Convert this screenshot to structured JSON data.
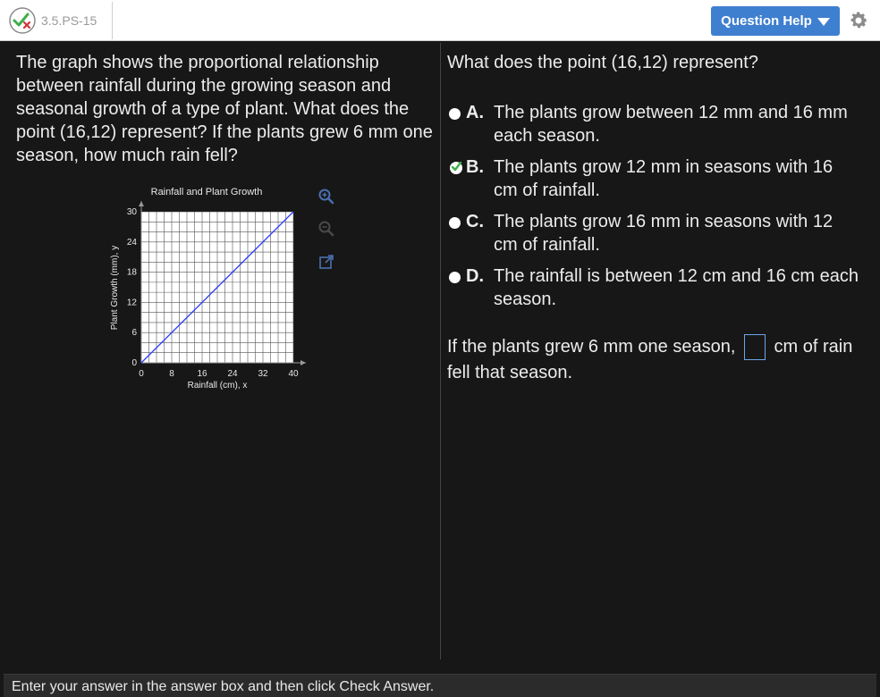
{
  "header": {
    "question_id": "3.5.PS-15",
    "help_button": "Question Help",
    "status_icon": "check-x-icon",
    "settings_icon": "gear-icon"
  },
  "prompt": "The graph shows the proportional relationship between rainfall during the growing season and seasonal growth of a type of plant. What does the point (16,12) represent? If the plants grew 6 mm one season, how much rain fell?",
  "chart_data": {
    "type": "line",
    "title": "Rainfall and Plant Growth",
    "xlabel": "Rainfall (cm), x",
    "ylabel": "Plant Growth (mm), y",
    "xlim": [
      0,
      40
    ],
    "ylim": [
      0,
      30
    ],
    "x_ticks": [
      0,
      8,
      16,
      24,
      32,
      40
    ],
    "y_ticks": [
      0,
      6,
      12,
      18,
      24,
      30
    ],
    "grid": true,
    "series": [
      {
        "x": [
          0,
          40
        ],
        "y": [
          0,
          30
        ],
        "color": "#2a3bff"
      }
    ]
  },
  "tools": [
    "zoom-in-icon",
    "zoom-out-icon",
    "popout-icon"
  ],
  "right": {
    "question": "What does the point (16,12) represent?",
    "options": [
      {
        "letter": "A.",
        "text": "The plants grow between 12 mm and 16 mm each season.",
        "selected": false
      },
      {
        "letter": "B.",
        "text": "The plants grow 12 mm in seasons with 16 cm of rainfall.",
        "selected": true
      },
      {
        "letter": "C.",
        "text": "The plants grow 16 mm in seasons with 12 cm of rainfall.",
        "selected": false
      },
      {
        "letter": "D.",
        "text": "The rainfall is between 12 cm and 16 cm each season.",
        "selected": false
      }
    ],
    "fill_before": "If the plants grew 6 mm one season,",
    "fill_value": "",
    "fill_after": "cm of rain fell that season."
  },
  "footer": "Enter your answer in the answer box and then click Check Answer."
}
